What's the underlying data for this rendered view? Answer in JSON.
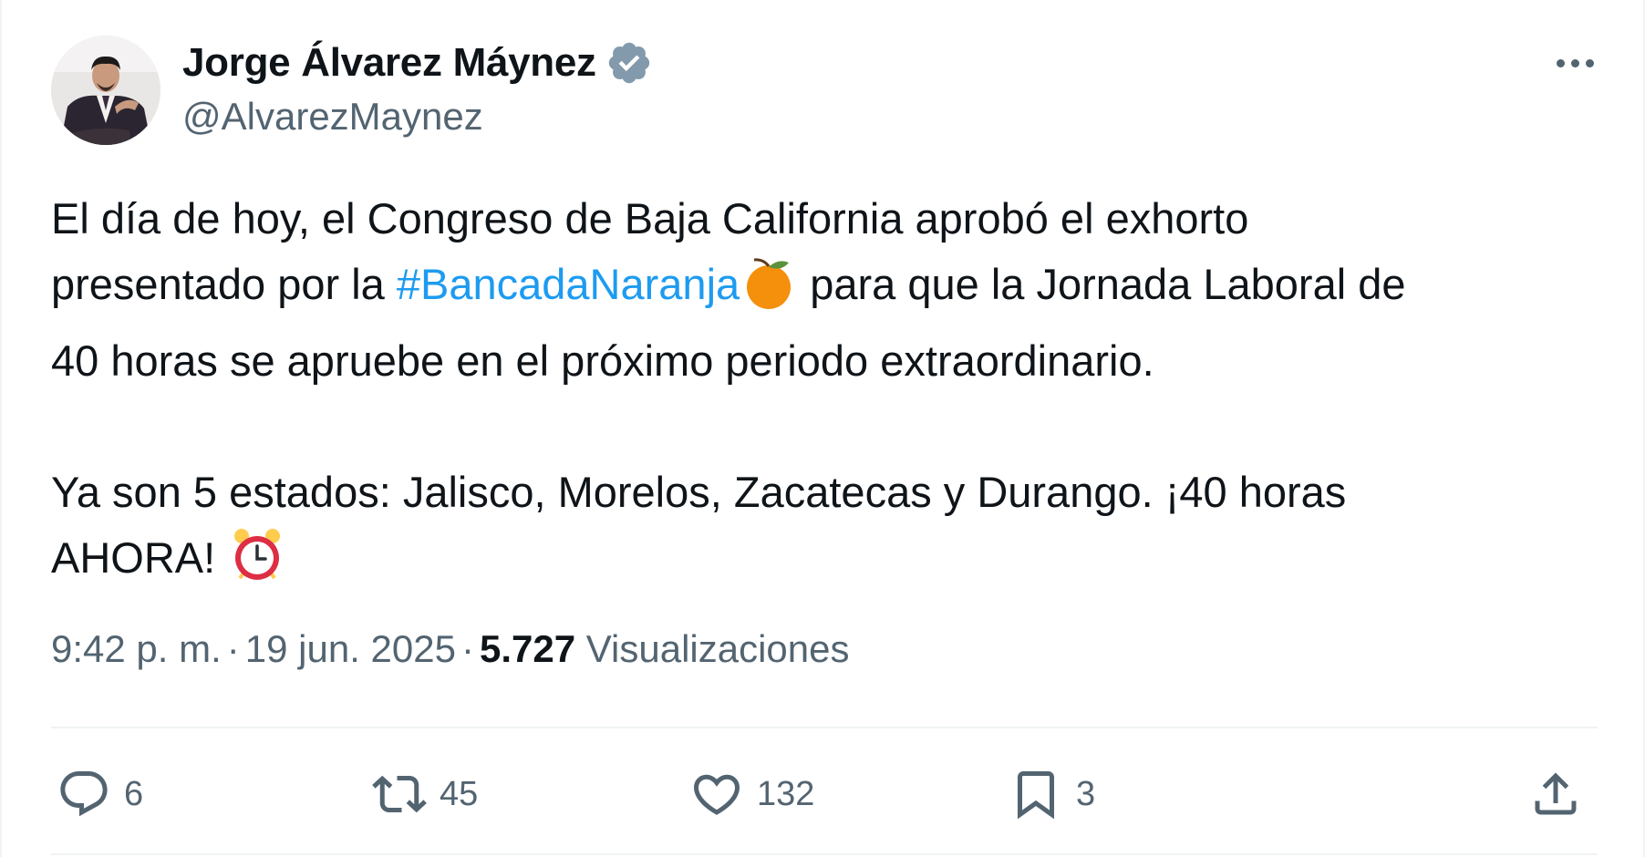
{
  "author": {
    "display_name": "Jorge Álvarez Máynez",
    "handle": "@AlvarezMaynez",
    "verified": true
  },
  "tweet": {
    "line1": "El día de hoy, el Congreso de Baja California aprobó el exhorto",
    "line2_prefix": "presentado por la ",
    "hashtag": "#BancadaNaranja",
    "line2_suffix": " para que la Jornada Laboral de",
    "line3": "40 horas se apruebe en el próximo periodo extraordinario.",
    "line4": "Ya son 5 estados: Jalisco, Morelos, Zacatecas y Durango. ¡40 horas",
    "line5": "AHORA! ",
    "emoji_orange": "tangerine-emoji",
    "emoji_clock": "alarm-clock-emoji"
  },
  "meta": {
    "time": "9:42 p. m.",
    "separator": "·",
    "date": "19 jun. 2025",
    "views_count": "5.727",
    "views_label": "Visualizaciones"
  },
  "actions": {
    "replies": "6",
    "reposts": "45",
    "likes": "132",
    "bookmarks": "3"
  },
  "colors": {
    "text": "#0f1419",
    "secondary": "#536471",
    "link": "#1d9bf0",
    "verified": "#829aab",
    "divider": "#eff3f4"
  }
}
